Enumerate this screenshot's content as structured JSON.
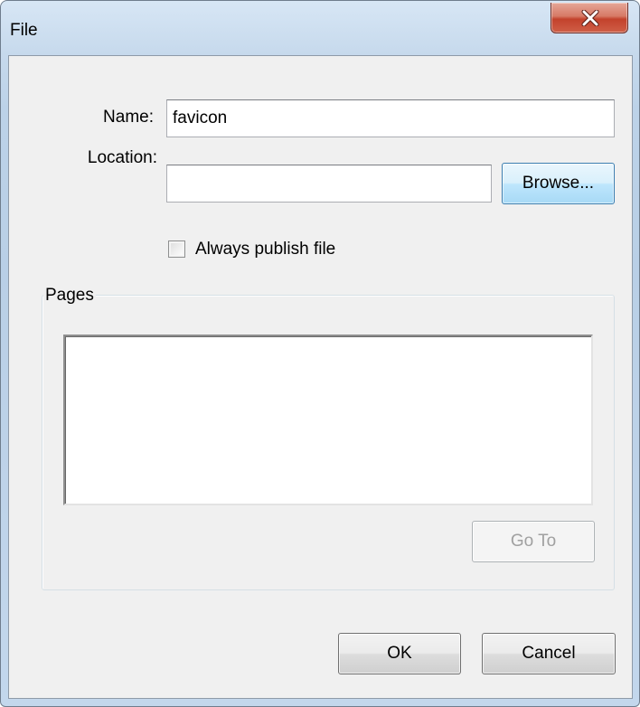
{
  "window": {
    "title": "File"
  },
  "icons": {
    "close": "close-icon"
  },
  "form": {
    "name_label": "Name:",
    "name_value": "favicon",
    "location_label": "Location:",
    "location_value": "",
    "browse_label": "Browse...",
    "always_publish_label": "Always publish file",
    "always_publish_checked": false
  },
  "pages": {
    "group_label": "Pages",
    "items": [],
    "goto_label": "Go To"
  },
  "footer": {
    "ok_label": "OK",
    "cancel_label": "Cancel"
  },
  "colors": {
    "close_button": "#c3422c",
    "browse_highlight": "#a7d9f5",
    "dialog_face": "#f0f0f0"
  }
}
